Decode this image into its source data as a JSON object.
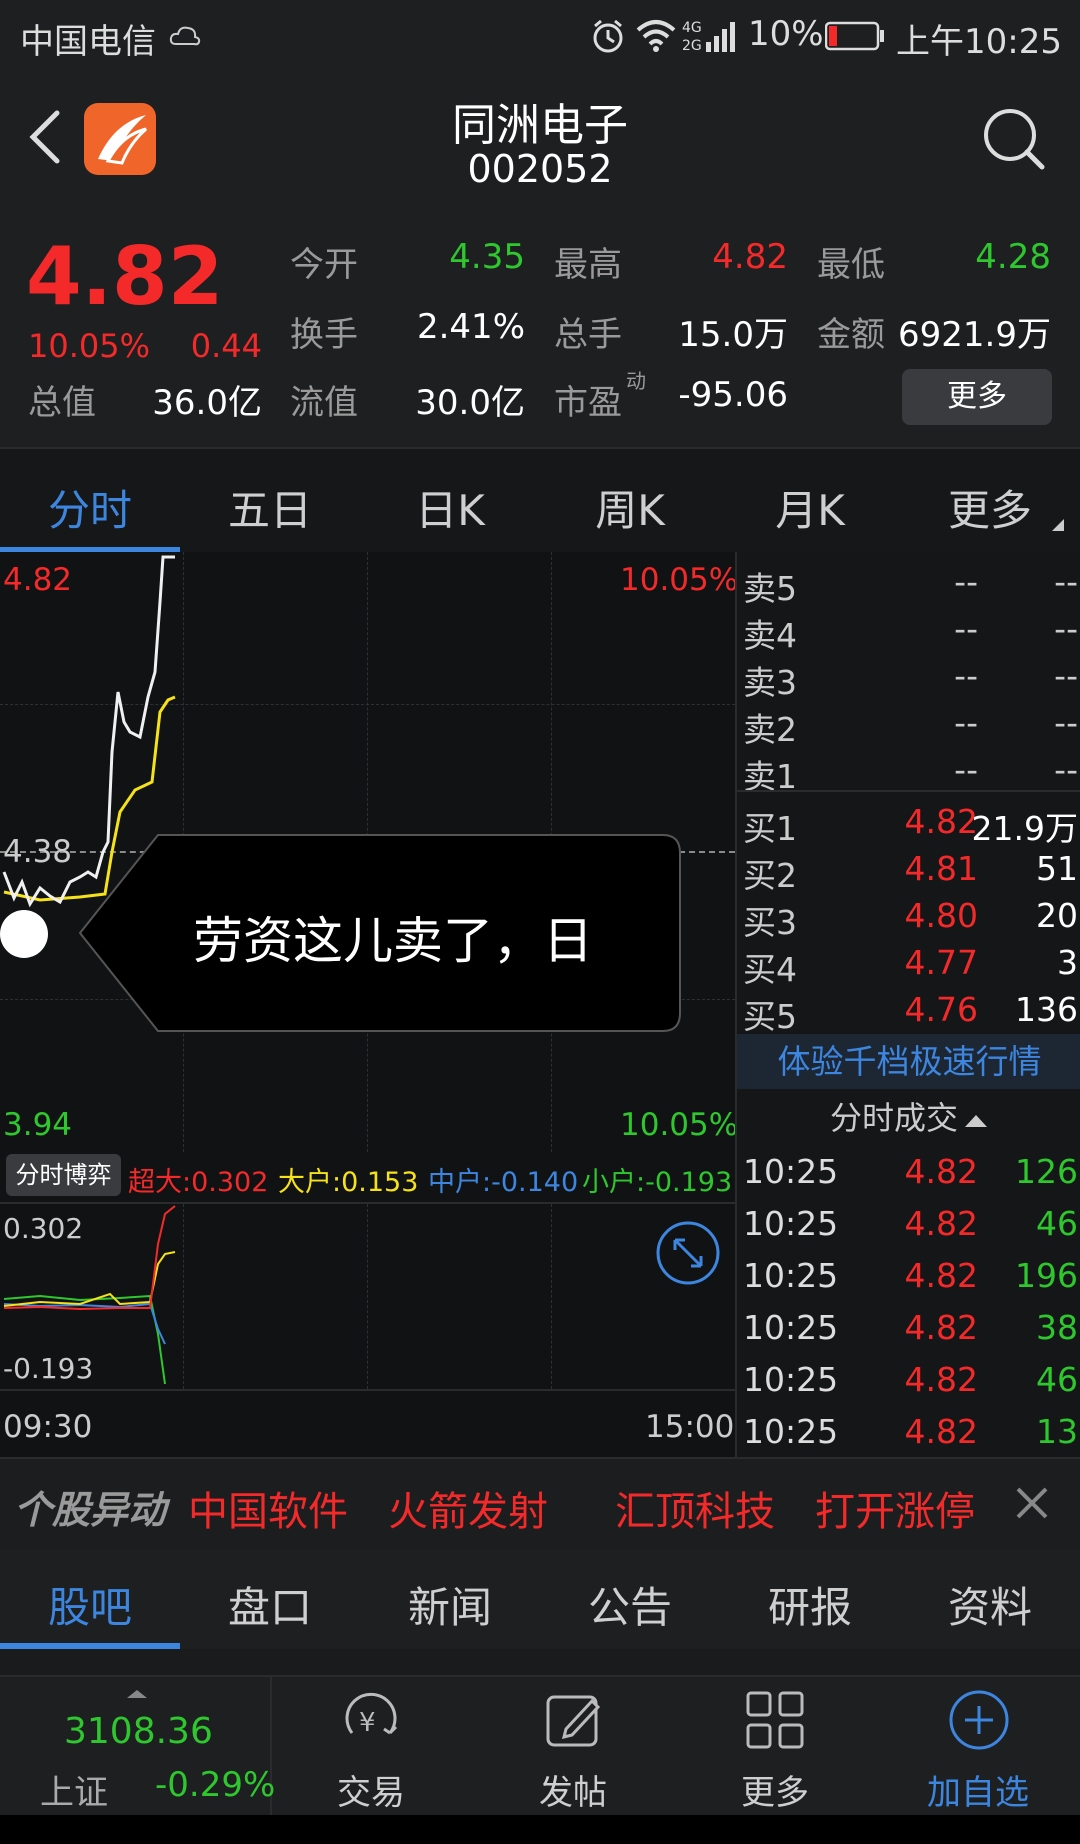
{
  "status_bar": {
    "carrier": "中国电信",
    "battery": "10%",
    "time": "上午10:25"
  },
  "header": {
    "stock_name": "同洲电子",
    "stock_code": "002052"
  },
  "quote": {
    "price": "4.82",
    "change_pct": "10.05%",
    "change": "0.44",
    "fields": [
      {
        "label": "今开",
        "value": "4.35",
        "color": "green"
      },
      {
        "label": "最高",
        "value": "4.82",
        "color": "red"
      },
      {
        "label": "最低",
        "value": "4.28",
        "color": "green"
      },
      {
        "label": "换手",
        "value": "2.41%",
        "color": "white"
      },
      {
        "label": "总手",
        "value": "15.0万",
        "color": "white"
      },
      {
        "label": "金额",
        "value": "6921.9万",
        "color": "white"
      },
      {
        "label": "总值",
        "value": "36.0亿",
        "color": "white"
      },
      {
        "label": "流值",
        "value": "30.0亿",
        "color": "white"
      },
      {
        "label": "市盈",
        "value": "-95.06",
        "color": "white"
      }
    ],
    "pe_superscript": "动",
    "more_button": "更多"
  },
  "tabs": [
    "分时",
    "五日",
    "日K",
    "周K",
    "月K",
    "更多"
  ],
  "chart": {
    "y_top": "4.82",
    "y_top_pct": "10.05%",
    "y_mid": "4.38",
    "y_bottom": "3.94",
    "y_bottom_pct": "10.05%",
    "indicator_button": "分时博弈",
    "indicators": [
      {
        "label": "超大:0.302",
        "color": "#f42a2a"
      },
      {
        "label": "大户:0.153",
        "color": "#f5e218"
      },
      {
        "label": "中户:-0.140",
        "color": "#3d86e0"
      },
      {
        "label": "小户:-0.193",
        "color": "#2ec82e"
      }
    ],
    "sub_top": "0.302",
    "sub_bottom": "-0.193",
    "time_start": "09:30",
    "time_end": "15:00",
    "toast_text": "劳资这儿卖了，日"
  },
  "order_book": {
    "asks": [
      {
        "label": "卖5",
        "price": "--",
        "volume": "--"
      },
      {
        "label": "卖4",
        "price": "--",
        "volume": "--"
      },
      {
        "label": "卖3",
        "price": "--",
        "volume": "--"
      },
      {
        "label": "卖2",
        "price": "--",
        "volume": "--"
      },
      {
        "label": "卖1",
        "price": "--",
        "volume": "--"
      }
    ],
    "bids": [
      {
        "label": "买1",
        "price": "4.82",
        "volume": "21.9万"
      },
      {
        "label": "买2",
        "price": "4.81",
        "volume": "51"
      },
      {
        "label": "买3",
        "price": "4.80",
        "volume": "20"
      },
      {
        "label": "买4",
        "price": "4.77",
        "volume": "3"
      },
      {
        "label": "买5",
        "price": "4.76",
        "volume": "136"
      }
    ],
    "promo": "体验千档极速行情",
    "trades_header": "分时成交",
    "trades": [
      {
        "time": "10:25",
        "price": "4.82",
        "volume": "126"
      },
      {
        "time": "10:25",
        "price": "4.82",
        "volume": "46"
      },
      {
        "time": "10:25",
        "price": "4.82",
        "volume": "196"
      },
      {
        "time": "10:25",
        "price": "4.82",
        "volume": "38"
      },
      {
        "time": "10:25",
        "price": "4.82",
        "volume": "46"
      },
      {
        "time": "10:25",
        "price": "4.82",
        "volume": "13"
      }
    ]
  },
  "alert": {
    "title": "个股异动",
    "items": [
      "中国软件",
      "火箭发射",
      "汇顶科技",
      "打开涨停"
    ]
  },
  "bottom_tabs": [
    "股吧",
    "盘口",
    "新闻",
    "公告",
    "研报",
    "资料"
  ],
  "bottom_nav": {
    "index_value": "3108.36",
    "index_name": "上证",
    "index_change": "-0.29%",
    "items": [
      {
        "label": "交易",
        "icon": "yen-cycle-icon"
      },
      {
        "label": "发帖",
        "icon": "edit-icon"
      },
      {
        "label": "更多",
        "icon": "grid-icon"
      },
      {
        "label": "加自选",
        "icon": "plus-circle-icon"
      }
    ]
  }
}
